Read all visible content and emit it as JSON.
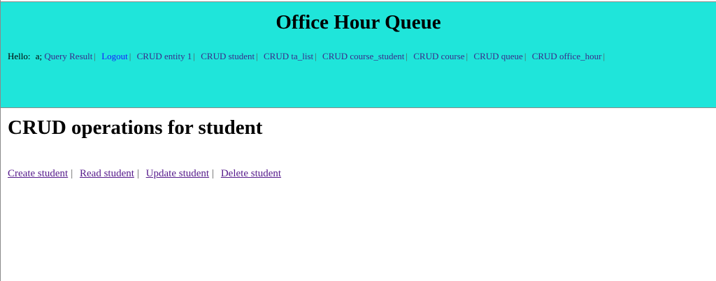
{
  "header": {
    "title": "Office Hour Queue",
    "greeting": "Hello:",
    "user": "a;",
    "nav": [
      {
        "label": "Query Result"
      },
      {
        "label": "Logout"
      },
      {
        "label": "CRUD entity 1"
      },
      {
        "label": "CRUD student"
      },
      {
        "label": "CRUD ta_list"
      },
      {
        "label": "CRUD course_student"
      },
      {
        "label": "CRUD course"
      },
      {
        "label": "CRUD queue"
      },
      {
        "label": "CRUD office_hour"
      }
    ],
    "separator": "|",
    "background": "#1fe5da"
  },
  "main": {
    "title": "CRUD operations for student",
    "operations": [
      {
        "label": "Create student"
      },
      {
        "label": "Read student"
      },
      {
        "label": "Update student"
      },
      {
        "label": "Delete student"
      }
    ],
    "separator": "|"
  }
}
